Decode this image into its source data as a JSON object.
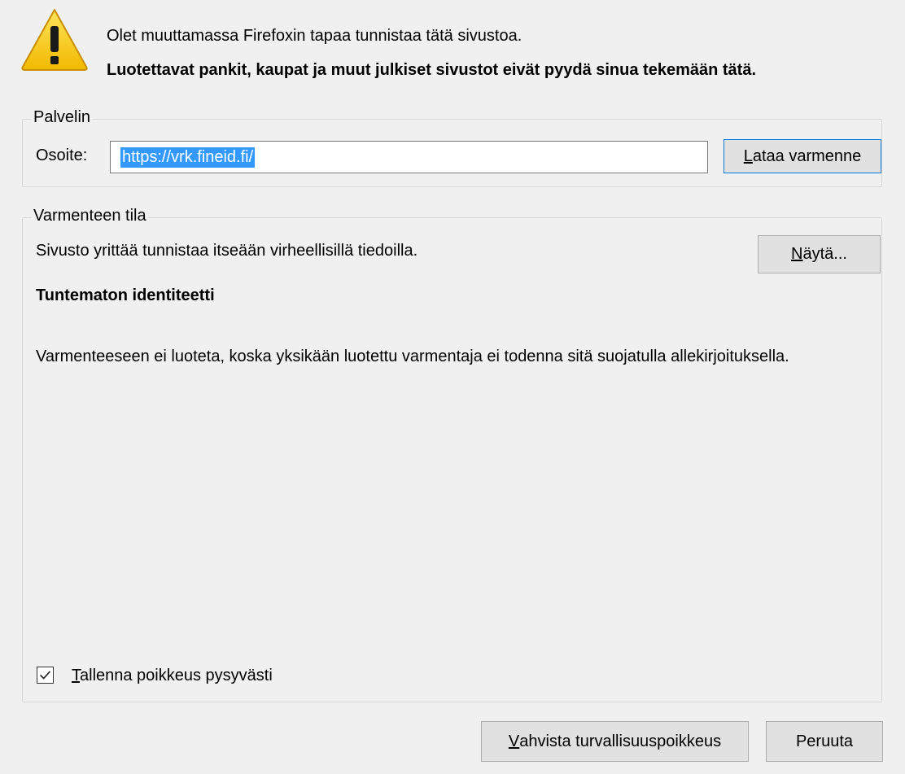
{
  "intro": {
    "line1": "Olet muuttamassa Firefoxin tapaa tunnistaa tätä sivustoa.",
    "line2": "Luotettavat pankit, kaupat ja muut julkiset sivustot eivät pyydä sinua tekemään tätä."
  },
  "server": {
    "legend": "Palvelin",
    "address_label": "Osoite:",
    "address_value": "https://vrk.fineid.fi/",
    "load_button": {
      "accel": "L",
      "rest": "ataa varmenne"
    }
  },
  "status": {
    "legend": "Varmenteen tila",
    "message": "Sivusto yrittää tunnistaa itseään virheellisillä tiedoilla.",
    "show_button": {
      "accel": "N",
      "rest": "äytä..."
    },
    "identity_heading": "Tuntematon identiteetti",
    "identity_text": "Varmenteeseen ei luoteta, koska yksikään luotettu varmentaja ei todenna sitä suojatulla allekirjoituksella.",
    "save_checkbox": {
      "checked": true,
      "accel": "T",
      "rest": "allenna poikkeus pysyvästi"
    }
  },
  "footer": {
    "confirm_button": {
      "accel": "V",
      "rest": "ahvista turvallisuuspoikkeus"
    },
    "cancel_button": "Peruuta"
  },
  "icons": {
    "warning": "warning-icon",
    "checkbox_check": "checkmark-icon"
  },
  "colors": {
    "accent": "#0078d7",
    "selection": "#3399ff",
    "warning_yellow": "#f5c400",
    "dialog_bg": "#f0f0f0"
  }
}
